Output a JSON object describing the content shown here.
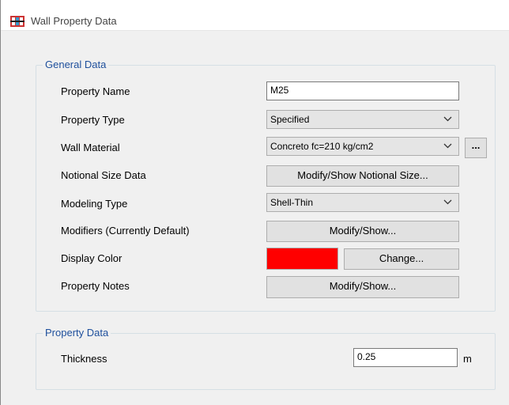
{
  "window": {
    "title": "Wall Property Data"
  },
  "general": {
    "legend": "General Data",
    "property_name_label": "Property Name",
    "property_name_value": "M25",
    "property_type_label": "Property Type",
    "property_type_value": "Specified",
    "wall_material_label": "Wall Material",
    "wall_material_value": "Concreto fc=210 kg/cm2",
    "wall_material_button": "...",
    "notional_label": "Notional Size Data",
    "notional_button": "Modify/Show Notional Size...",
    "modeling_type_label": "Modeling Type",
    "modeling_type_value": "Shell-Thin",
    "modifiers_label": "Modifiers (Currently Default)",
    "modifiers_button": "Modify/Show...",
    "display_color_label": "Display Color",
    "display_color_value": "#ff0000",
    "display_color_button": "Change...",
    "notes_label": "Property Notes",
    "notes_button": "Modify/Show..."
  },
  "property": {
    "legend": "Property Data",
    "thickness_label": "Thickness",
    "thickness_value": "0.25",
    "thickness_unit": "m"
  },
  "colors": {
    "group_title": "#1e4f9c",
    "border": "#d5dfe5"
  }
}
